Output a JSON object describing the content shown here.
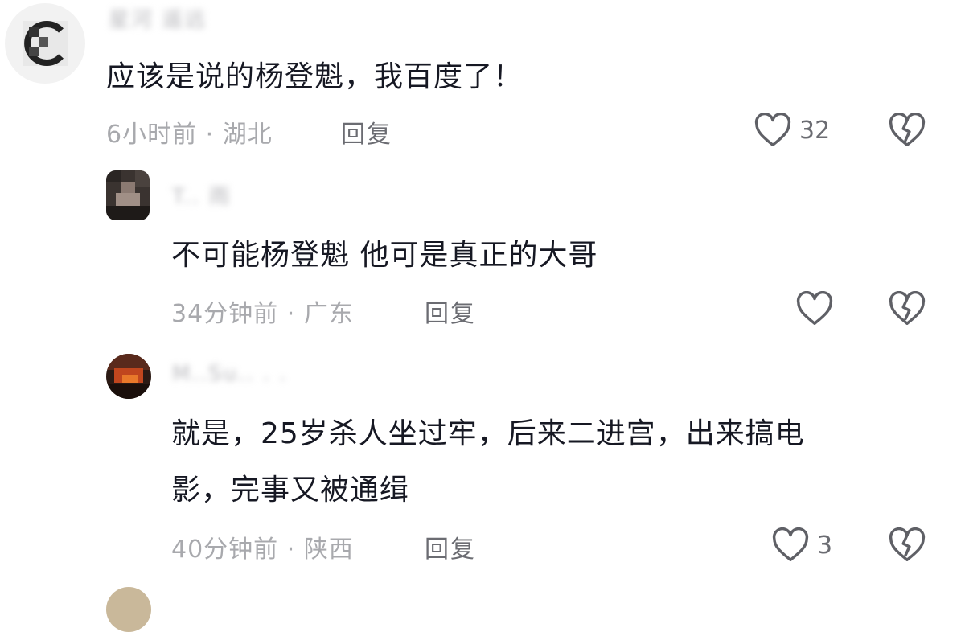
{
  "comments": [
    {
      "username": "星河 遥远",
      "text": "应该是说的杨登魁，我百度了！",
      "time": "6小时前",
      "location": "湖北",
      "reply_label": "回复",
      "likes": "32"
    },
    {
      "username": "T.. 雨",
      "text": "不可能杨登魁 他可是真正的大哥",
      "time": "34分钟前",
      "location": "广东",
      "reply_label": "回复",
      "likes": ""
    },
    {
      "username": "M..Su.. . .",
      "text_line1": "就是，25岁杀人坐过牢，后来二进宫，出来搞电",
      "text_line2": "影，完事又被通缉",
      "time": "40分钟前",
      "location": "陕西",
      "reply_label": "回复",
      "likes": "3"
    }
  ],
  "separator": "·",
  "colors": {
    "text": "#161823",
    "meta": "#a8a9ad",
    "action": "#6b6c72"
  },
  "icons": {
    "like": "heart-outline-icon",
    "dislike": "broken-heart-icon"
  }
}
